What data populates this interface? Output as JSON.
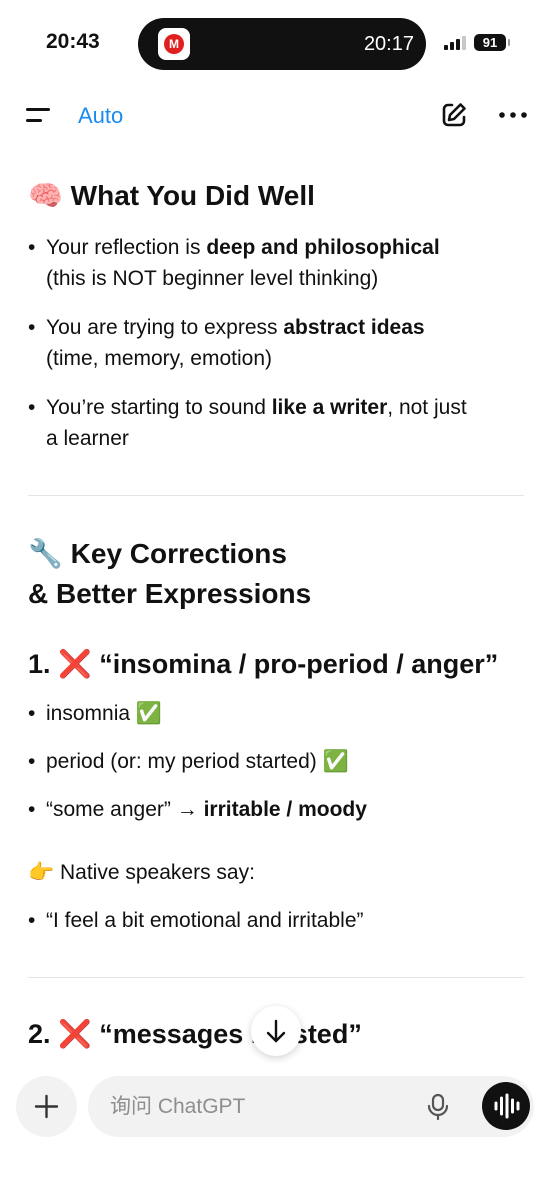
{
  "status_bar": {
    "time": "20:43",
    "island_app_letter": "M",
    "island_time": "20:17",
    "battery": "91"
  },
  "nav": {
    "model_label": "Auto"
  },
  "sections": {
    "well": {
      "icon": "🧠",
      "title": "What You Did Well",
      "b1_a": "Your reflection is ",
      "b1_b": "deep and philosophical",
      "b1_c": "(this is NOT beginner level thinking)",
      "b2_a": "You are trying to express ",
      "b2_b": "abstract ideas",
      "b2_c": "(time, memory, emotion)",
      "b3_a": "You’re starting to sound ",
      "b3_b": "like a writer",
      "b3_c": ", not just",
      "b3_d": "a learner"
    },
    "corrections": {
      "icon": "🔧",
      "title_line1": "Key Corrections",
      "title_line2": "& Better Expressions"
    },
    "item1": {
      "number": "1.",
      "icon": "❌",
      "title": "“insomina / pro-period / anger”",
      "b1": "insomnia",
      "b1_icon": "✅",
      "b2": "period (or: my period started)",
      "b2_icon": "✅",
      "b3_a": "“some anger” → ",
      "b3_b": "irritable / moody",
      "native_icon": "👉",
      "native": "Native speakers say:",
      "quote": "“I feel a bit emotional and irritable”"
    },
    "item2": {
      "number": "2.",
      "icon": "❌",
      "title_a": "“messages i",
      "title_b": "rsted”"
    }
  },
  "composer": {
    "placeholder": "询问 ChatGPT"
  },
  "bullet_char": "•"
}
